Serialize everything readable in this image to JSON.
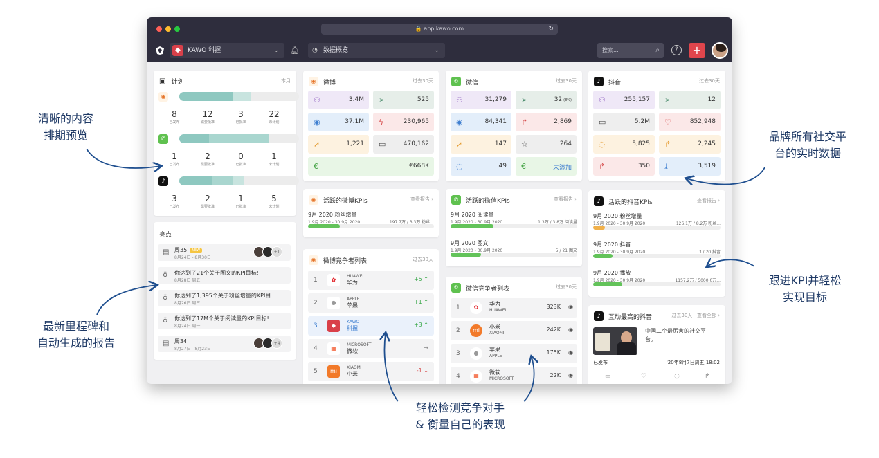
{
  "browser": {
    "url": "app.kawo.com"
  },
  "appbar": {
    "brand": "KAWO 科握",
    "dashboard": "数据概览",
    "search_placeholder": "搜索..."
  },
  "plan": {
    "title": "计划",
    "period": "本月",
    "weibo": {
      "stats": [
        {
          "n": "8",
          "l": "已发布"
        },
        {
          "n": "12",
          "l": "需要批准"
        },
        {
          "n": "3",
          "l": "已批准"
        },
        {
          "n": "22",
          "l": "未计划"
        }
      ],
      "fills": [
        {
          "w": 0.45,
          "c": "#8ec8c0"
        },
        {
          "w": 0.15,
          "c": "#c8e4df"
        }
      ]
    },
    "wechat": {
      "stats": [
        {
          "n": "1",
          "l": "已发布"
        },
        {
          "n": "2",
          "l": "需要批准"
        },
        {
          "n": "0",
          "l": "已批准"
        },
        {
          "n": "1",
          "l": "未计划"
        }
      ],
      "fills": [
        {
          "w": 0.25,
          "c": "#8ec8c0"
        },
        {
          "w": 0.5,
          "c": "#a9d6cf"
        }
      ]
    },
    "douyin": {
      "stats": [
        {
          "n": "3",
          "l": "已发布"
        },
        {
          "n": "2",
          "l": "需要批准"
        },
        {
          "n": "1",
          "l": "已批准"
        },
        {
          "n": "5",
          "l": "未计划"
        }
      ],
      "fills": [
        {
          "w": 0.27,
          "c": "#8ec8c0"
        },
        {
          "w": 0.18,
          "c": "#a9d6cf"
        },
        {
          "w": 0.09,
          "c": "#c8e4df"
        }
      ]
    }
  },
  "highlights": {
    "title": "亮点",
    "badge": "NEW",
    "items": [
      {
        "t1": "周35",
        "t2": "8月24日 - 8月30日",
        "icon": "report-icon",
        "avatars": true
      },
      {
        "t1": "你达到了21个关于图文的KPI目标!",
        "t2": "8月28日 周五",
        "icon": "award-icon"
      },
      {
        "t1": "你达到了1,395个关于粉丝增量的KPI目...",
        "t2": "8月26日 周三",
        "icon": "award-icon"
      },
      {
        "t1": "你达到了17M个关于阅读量的KPI目标!",
        "t2": "8月24日 周一",
        "icon": "award-icon"
      },
      {
        "t1": "周34",
        "t2": "8月27日 - 8月23日",
        "icon": "report-icon",
        "avatars": true
      }
    ],
    "more": "+1",
    "more2": "+4"
  },
  "weibo": {
    "title": "微博",
    "period": "过去30天",
    "tiles": [
      {
        "v": "3.4M",
        "bg": "#efe8f7",
        "ic": "#9a6fc7",
        "icon": "fans-icon"
      },
      {
        "v": "525",
        "bg": "#e6eee9",
        "ic": "#4c8c6d",
        "icon": "send-icon"
      },
      {
        "v": "37.1M",
        "bg": "#e3eefa",
        "ic": "#3f7fd0",
        "icon": "eye-icon"
      },
      {
        "v": "230,965",
        "bg": "#fbe8e8",
        "ic": "#d64b4b",
        "icon": "bolt-icon"
      },
      {
        "v": "1,221",
        "bg": "#fdf2e0",
        "ic": "#e49a2e",
        "icon": "cursor-icon"
      },
      {
        "v": "470,162",
        "bg": "#eeeeee",
        "ic": "#555",
        "icon": "video-icon"
      },
      {
        "v": "€668K",
        "bg": "#e8f6e6",
        "ic": "#4aa64a",
        "icon": "euro-icon",
        "wide": true
      }
    ]
  },
  "wechat": {
    "title": "微信",
    "period": "过去30天",
    "tiles": [
      {
        "v": "31,279",
        "bg": "#efe8f7",
        "ic": "#9a6fc7",
        "icon": "fans-icon"
      },
      {
        "v": "32",
        "sub": "(8%)",
        "bg": "#e6eee9",
        "ic": "#4c8c6d",
        "icon": "send-icon"
      },
      {
        "v": "84,341",
        "bg": "#e3eefa",
        "ic": "#3f7fd0",
        "icon": "eye-icon"
      },
      {
        "v": "2,869",
        "bg": "#fbe8e8",
        "ic": "#d64b4b",
        "icon": "share-icon"
      },
      {
        "v": "147",
        "bg": "#fdf2e0",
        "ic": "#e49a2e",
        "icon": "cursor-icon"
      },
      {
        "v": "264",
        "bg": "#eeeeee",
        "ic": "#555",
        "icon": "star-icon"
      },
      {
        "v": "49",
        "bg": "#e3eefa",
        "ic": "#3f7fd0",
        "icon": "comment-icon"
      },
      {
        "v": "未添加",
        "bg": "#e8f6e6",
        "ic": "#4aa64a",
        "icon": "euro-icon",
        "vc": "#3f7fd0"
      }
    ]
  },
  "douyin": {
    "title": "抖音",
    "period": "过去30天",
    "tiles": [
      {
        "v": "255,157",
        "bg": "#efe8f7",
        "ic": "#9a6fc7",
        "icon": "fans-icon"
      },
      {
        "v": "12",
        "bg": "#e6eee9",
        "ic": "#4c8c6d",
        "icon": "send-icon"
      },
      {
        "v": "5.2M",
        "bg": "#eeeeee",
        "ic": "#555",
        "icon": "video-icon"
      },
      {
        "v": "852,948",
        "bg": "#fbe8e8",
        "ic": "#d64b4b",
        "icon": "heart-icon"
      },
      {
        "v": "5,825",
        "bg": "#fdf2e0",
        "ic": "#e49a2e",
        "icon": "comment-icon"
      },
      {
        "v": "2,245",
        "bg": "#fdf2e0",
        "ic": "#e49a2e",
        "icon": "share-icon"
      },
      {
        "v": "350",
        "bg": "#fbe8e8",
        "ic": "#d64b4b",
        "icon": "share-icon"
      },
      {
        "v": "3,519",
        "bg": "#e3eefa",
        "ic": "#3f7fd0",
        "icon": "download-icon"
      }
    ]
  },
  "weibo_kpi": {
    "title": "活跃的微博KPIs",
    "link": "查看报告 ›",
    "items": [
      {
        "t": "9月 2020 粉丝增量",
        "d": "1.9月 2020 - 30.9月 2020",
        "r": "197.7万 / 3.3万 粉丝...",
        "p": 0.25,
        "c": "#63c35a"
      }
    ]
  },
  "wechat_kpi": {
    "title": "活跃的微信KPIs",
    "link": "查看报告 ›",
    "items": [
      {
        "t": "9月 2020 阅读量",
        "d": "1.9月 2020 - 30.9月 2020",
        "r": "1.3万 / 3.8万 阅读量",
        "p": 0.34,
        "c": "#63c35a"
      },
      {
        "t": "9月 2020 图文",
        "d": "1.9月 2020 - 30.9月 2020",
        "r": "5 / 21 图文",
        "p": 0.24,
        "c": "#63c35a"
      }
    ]
  },
  "douyin_kpi": {
    "title": "活跃的抖音KPIs",
    "link": "查看报告 ›",
    "items": [
      {
        "t": "9月 2020 粉丝增量",
        "d": "1.9月 2020 - 30.9月 2020",
        "r": "126.1万 / 8.2万 粉丝...",
        "p": 0.09,
        "c": "#f0b04a"
      },
      {
        "t": "9月 2020 抖音",
        "d": "1.9月 2020 - 30.9月 2020",
        "r": "3 / 20 抖音",
        "p": 0.15,
        "c": "#63c35a"
      },
      {
        "t": "9月 2020 播放",
        "d": "1.9月 2020 - 30.9月 2020",
        "r": "1157.2万 / 5000.0万...",
        "p": 0.23,
        "c": "#63c35a"
      }
    ]
  },
  "weibo_comp": {
    "title": "微博竞争者列表",
    "period": "过去30天",
    "rows": [
      {
        "rank": "1",
        "en": "HUAWEI",
        "cn": "华为",
        "change": "+5 ↑",
        "cc": "#3aa84a",
        "logo": "huawei",
        "lbg": "#fff"
      },
      {
        "rank": "2",
        "en": "APPLE",
        "cn": "苹果",
        "change": "+1 ↑",
        "cc": "#3aa84a",
        "logo": "apple",
        "lbg": "#fff"
      },
      {
        "rank": "3",
        "en": "KAWO",
        "cn": "科握",
        "change": "+3 ↑",
        "cc": "#3aa84a",
        "logo": "kawo",
        "lbg": "#d9404a",
        "hl": true
      },
      {
        "rank": "4",
        "en": "MICROSOFT",
        "cn": "微软",
        "change": "→",
        "cc": "#888",
        "logo": "ms",
        "lbg": "#fff"
      },
      {
        "rank": "5",
        "en": "XIAOMI",
        "cn": "小米",
        "change": "-1 ↓",
        "cc": "#d64b4b",
        "logo": "mi",
        "lbg": "#f27a2a"
      }
    ]
  },
  "wechat_comp": {
    "title": "微信竞争者列表",
    "period": "过去30天",
    "rows": [
      {
        "rank": "1",
        "cn": "华为",
        "en": "HUAWEI",
        "v": "323K",
        "logo": "huawei",
        "lbg": "#fff"
      },
      {
        "rank": "2",
        "cn": "小米",
        "en": "XIAOMI",
        "v": "242K",
        "logo": "mi",
        "lbg": "#f27a2a"
      },
      {
        "rank": "3",
        "cn": "苹果",
        "en": "APPLE",
        "v": "175K",
        "logo": "apple",
        "lbg": "#fff"
      },
      {
        "rank": "4",
        "cn": "微软",
        "en": "MICROSOFT",
        "v": "22K",
        "logo": "ms",
        "lbg": "#fff"
      }
    ]
  },
  "douyin_top": {
    "title": "互动最高的抖音",
    "period": "过去30天 · 查看全部 ›",
    "caption": "中国二个最厉害的社交平台。",
    "status": "已发布",
    "date": "'20年8月7日周五 18:02"
  },
  "annotations": {
    "a1": "清晰的内容\n排期预览",
    "a2": "最新里程碑和\n自动生成的报告",
    "a3": "品牌所有社交平\n台的实时数据",
    "a4": "跟进KPI并轻松\n实现目标",
    "a5": "轻松检测竞争对手\n& 衡量自己的表现"
  }
}
